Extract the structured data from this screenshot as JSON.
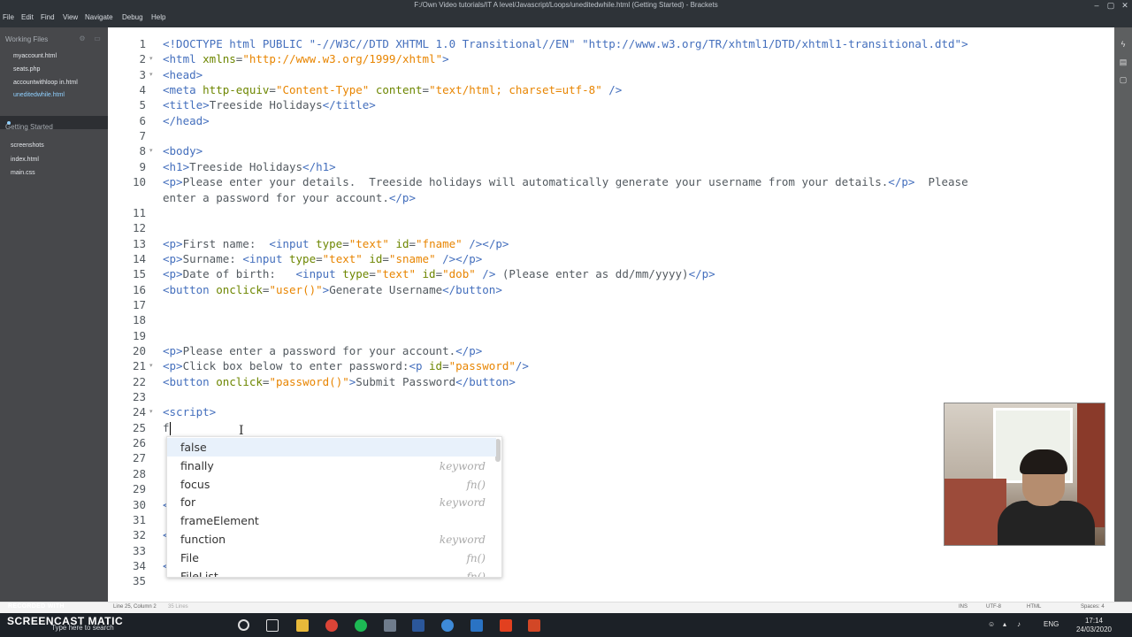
{
  "window": {
    "title": "F:/Own Video tutorials/IT A level/Javascript/Loops/uneditedwhile.html (Getting Started) - Brackets",
    "controls": [
      "–",
      "▢",
      "✕"
    ]
  },
  "menu": [
    "File",
    "Edit",
    "Find",
    "View",
    "Navigate",
    "Debug",
    "Help"
  ],
  "sidebar": {
    "working_files_label": "Working Files",
    "working_files": [
      "myaccount.html",
      "seats.php",
      "accountwithloop in.html",
      "uneditedwhile.html"
    ],
    "project_label": "Getting Started",
    "project_files": [
      "screenshots",
      "index.html",
      "main.css"
    ]
  },
  "editor": {
    "lines": [
      {
        "n": "1",
        "fold": "",
        "parts": [
          {
            "c": "t",
            "v": "<!DOCTYPE html PUBLIC \"-//W3C//DTD XHTML 1.0 Transitional//EN\" \"http://www.w3.org/TR/xhtml1/DTD/xhtml1-transitional.dtd\">"
          }
        ]
      },
      {
        "n": "2",
        "fold": "▾",
        "parts": [
          {
            "c": "t",
            "v": "<html "
          },
          {
            "c": "a",
            "v": "xmlns"
          },
          {
            "c": "",
            "v": "="
          },
          {
            "c": "s",
            "v": "\"http://www.w3.org/1999/xhtml\""
          },
          {
            "c": "t",
            "v": ">"
          }
        ]
      },
      {
        "n": "3",
        "fold": "▾",
        "parts": [
          {
            "c": "t",
            "v": "<head>"
          }
        ]
      },
      {
        "n": "4",
        "fold": "",
        "parts": [
          {
            "c": "t",
            "v": "<meta "
          },
          {
            "c": "a",
            "v": "http-equiv"
          },
          {
            "c": "",
            "v": "="
          },
          {
            "c": "s",
            "v": "\"Content-Type\""
          },
          {
            "c": "",
            "v": " "
          },
          {
            "c": "a",
            "v": "content"
          },
          {
            "c": "",
            "v": "="
          },
          {
            "c": "s",
            "v": "\"text/html; charset=utf-8\""
          },
          {
            "c": "t",
            "v": " />"
          }
        ]
      },
      {
        "n": "5",
        "fold": "",
        "parts": [
          {
            "c": "t",
            "v": "<title>"
          },
          {
            "c": "",
            "v": "Treeside Holidays"
          },
          {
            "c": "t",
            "v": "</title>"
          }
        ]
      },
      {
        "n": "6",
        "fold": "",
        "parts": [
          {
            "c": "t",
            "v": "</head>"
          }
        ]
      },
      {
        "n": "7",
        "fold": "",
        "parts": []
      },
      {
        "n": "8",
        "fold": "▾",
        "parts": [
          {
            "c": "t",
            "v": "<body>"
          }
        ]
      },
      {
        "n": "9",
        "fold": "",
        "parts": [
          {
            "c": "t",
            "v": "<h1>"
          },
          {
            "c": "",
            "v": "Treeside Holidays"
          },
          {
            "c": "t",
            "v": "</h1>"
          }
        ]
      },
      {
        "n": "10",
        "fold": "",
        "parts": [
          {
            "c": "t",
            "v": "<p>"
          },
          {
            "c": "",
            "v": "Please enter your details.  Treeside holidays will automatically generate your username from your details."
          },
          {
            "c": "t",
            "v": "</p>"
          },
          {
            "c": "",
            "v": "  Please"
          }
        ]
      },
      {
        "n": "",
        "fold": "",
        "parts": [
          {
            "c": "",
            "v": "enter a password for your account."
          },
          {
            "c": "t",
            "v": "</p>"
          }
        ]
      },
      {
        "n": "11",
        "fold": "",
        "parts": []
      },
      {
        "n": "12",
        "fold": "",
        "parts": []
      },
      {
        "n": "13",
        "fold": "",
        "parts": [
          {
            "c": "t",
            "v": "<p>"
          },
          {
            "c": "",
            "v": "First name:  "
          },
          {
            "c": "t",
            "v": "<input "
          },
          {
            "c": "a",
            "v": "type"
          },
          {
            "c": "",
            "v": "="
          },
          {
            "c": "s",
            "v": "\"text\""
          },
          {
            "c": "",
            "v": " "
          },
          {
            "c": "a",
            "v": "id"
          },
          {
            "c": "",
            "v": "="
          },
          {
            "c": "s",
            "v": "\"fname\""
          },
          {
            "c": "t",
            "v": " /></p>"
          }
        ]
      },
      {
        "n": "14",
        "fold": "",
        "parts": [
          {
            "c": "t",
            "v": "<p>"
          },
          {
            "c": "",
            "v": "Surname: "
          },
          {
            "c": "t",
            "v": "<input "
          },
          {
            "c": "a",
            "v": "type"
          },
          {
            "c": "",
            "v": "="
          },
          {
            "c": "s",
            "v": "\"text\""
          },
          {
            "c": "",
            "v": " "
          },
          {
            "c": "a",
            "v": "id"
          },
          {
            "c": "",
            "v": "="
          },
          {
            "c": "s",
            "v": "\"sname\""
          },
          {
            "c": "t",
            "v": " /></p>"
          }
        ]
      },
      {
        "n": "15",
        "fold": "",
        "parts": [
          {
            "c": "t",
            "v": "<p>"
          },
          {
            "c": "",
            "v": "Date of birth:   "
          },
          {
            "c": "t",
            "v": "<input "
          },
          {
            "c": "a",
            "v": "type"
          },
          {
            "c": "",
            "v": "="
          },
          {
            "c": "s",
            "v": "\"text\""
          },
          {
            "c": "",
            "v": " "
          },
          {
            "c": "a",
            "v": "id"
          },
          {
            "c": "",
            "v": "="
          },
          {
            "c": "s",
            "v": "\"dob\""
          },
          {
            "c": "t",
            "v": " />"
          },
          {
            "c": "",
            "v": " (Please enter as dd/mm/yyyy)"
          },
          {
            "c": "t",
            "v": "</p>"
          }
        ]
      },
      {
        "n": "16",
        "fold": "",
        "parts": [
          {
            "c": "t",
            "v": "<button "
          },
          {
            "c": "a",
            "v": "onclick"
          },
          {
            "c": "",
            "v": "="
          },
          {
            "c": "s",
            "v": "\"user()\""
          },
          {
            "c": "t",
            "v": ">"
          },
          {
            "c": "",
            "v": "Generate Username"
          },
          {
            "c": "t",
            "v": "</button>"
          }
        ]
      },
      {
        "n": "17",
        "fold": "",
        "parts": []
      },
      {
        "n": "18",
        "fold": "",
        "parts": []
      },
      {
        "n": "19",
        "fold": "",
        "parts": []
      },
      {
        "n": "20",
        "fold": "",
        "parts": [
          {
            "c": "t",
            "v": "<p>"
          },
          {
            "c": "",
            "v": "Please enter a password for your account."
          },
          {
            "c": "t",
            "v": "</p>"
          }
        ]
      },
      {
        "n": "21",
        "fold": "▾",
        "parts": [
          {
            "c": "t",
            "v": "<p>"
          },
          {
            "c": "",
            "v": "Click box below to enter password:"
          },
          {
            "c": "t",
            "v": "<p "
          },
          {
            "c": "a",
            "v": "id"
          },
          {
            "c": "",
            "v": "="
          },
          {
            "c": "s",
            "v": "\"password\""
          },
          {
            "c": "t",
            "v": "/>"
          }
        ]
      },
      {
        "n": "22",
        "fold": "",
        "parts": [
          {
            "c": "t",
            "v": "<button "
          },
          {
            "c": "a",
            "v": "onclick"
          },
          {
            "c": "",
            "v": "="
          },
          {
            "c": "s",
            "v": "\"password()\""
          },
          {
            "c": "t",
            "v": ">"
          },
          {
            "c": "",
            "v": "Submit Password"
          },
          {
            "c": "t",
            "v": "</button>"
          }
        ]
      },
      {
        "n": "23",
        "fold": "",
        "parts": []
      },
      {
        "n": "24",
        "fold": "▾",
        "parts": [
          {
            "c": "t",
            "v": "<script>"
          }
        ]
      },
      {
        "n": "25",
        "fold": "",
        "parts": [
          {
            "c": "",
            "v": "f"
          }
        ]
      },
      {
        "n": "26",
        "fold": "",
        "parts": []
      },
      {
        "n": "27",
        "fold": "",
        "parts": []
      },
      {
        "n": "28",
        "fold": "",
        "parts": []
      },
      {
        "n": "29",
        "fold": "",
        "parts": []
      },
      {
        "n": "30",
        "fold": "",
        "parts": [
          {
            "c": "t",
            "v": "<"
          }
        ]
      },
      {
        "n": "31",
        "fold": "",
        "parts": []
      },
      {
        "n": "32",
        "fold": "",
        "parts": [
          {
            "c": "t",
            "v": "<"
          }
        ]
      },
      {
        "n": "33",
        "fold": "",
        "parts": []
      },
      {
        "n": "34",
        "fold": "",
        "parts": [
          {
            "c": "t",
            "v": "<"
          }
        ]
      },
      {
        "n": "35",
        "fold": "",
        "parts": []
      }
    ]
  },
  "hints": [
    {
      "name": "false",
      "kind": ""
    },
    {
      "name": "finally",
      "kind": "keyword"
    },
    {
      "name": "focus",
      "kind": "fn()"
    },
    {
      "name": "for",
      "kind": "keyword"
    },
    {
      "name": "frameElement",
      "kind": ""
    },
    {
      "name": "function",
      "kind": "keyword"
    },
    {
      "name": "File",
      "kind": "fn()"
    },
    {
      "name": "FileList",
      "kind": "fn()"
    }
  ],
  "statusbar": {
    "position": "Line 25, Column 2",
    "lines": "35 Lines",
    "mode": "INS",
    "encoding": "UTF-8",
    "language": "HTML",
    "spaces": "Spaces: 4"
  },
  "taskbar": {
    "recorded_label": "RECORDED WITH",
    "brand": "SCREENCAST MATIC",
    "search_placeholder": "Type here to search",
    "language": "ENG",
    "time": "17:14",
    "date": "24/03/2020"
  },
  "colors": {
    "tag": "#446fbd",
    "attribute": "#6d8600",
    "string": "#e88501",
    "sidebar": "#47484b",
    "active_file": "#8fd0ff"
  }
}
